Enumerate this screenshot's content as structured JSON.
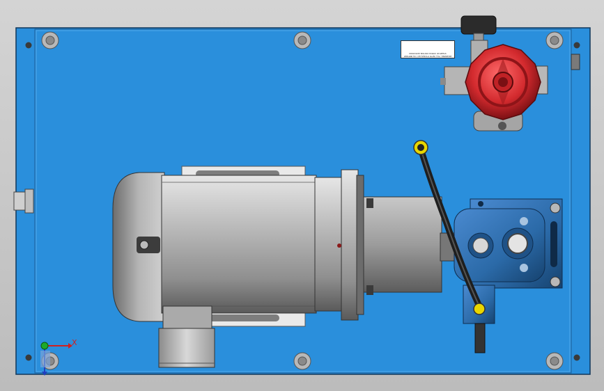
{
  "viewport": {
    "background_color": "#c9c9c9",
    "base_plate_color": "#2a8fdc"
  },
  "plate_label": {
    "text": "WARNING: FILL WITH HYDRAULIC OIL BEFORE STARTUP. CHECK MOTOR ROTATION"
  },
  "triad": {
    "x_label": "X"
  },
  "parts": {
    "motor_color": "#a8a8a8",
    "pump_color": "#2b6aa8",
    "valve_knob_color": "#c8282c",
    "hose_color": "#1e1e1e",
    "fitting_color": "#e8d600"
  }
}
